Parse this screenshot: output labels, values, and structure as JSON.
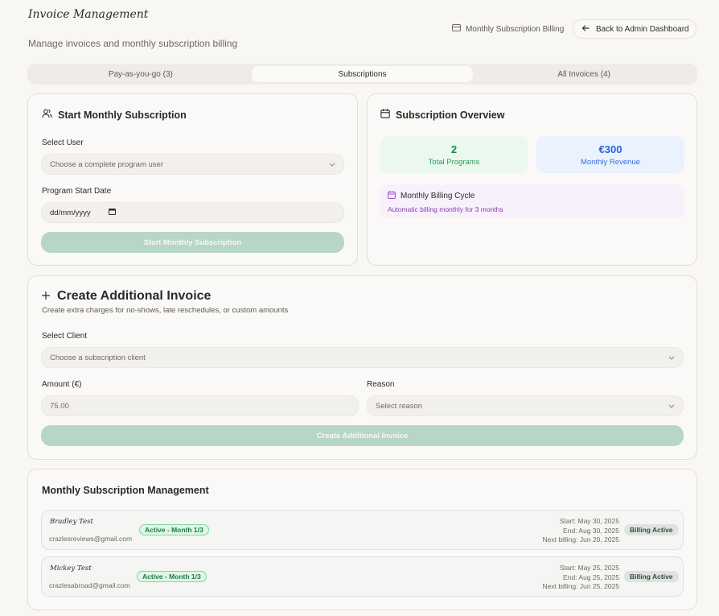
{
  "header": {
    "title": "Invoice Management",
    "subtitle": "Manage invoices and monthly subscription billing",
    "billing_label": "Monthly Subscription Billing",
    "back_label": "Back to Admin Dashboard"
  },
  "tabs": [
    {
      "label": "Pay-as-you-go (3)"
    },
    {
      "label": "Subscriptions"
    },
    {
      "label": "All Invoices (4)"
    }
  ],
  "start_subscription": {
    "title": "Start Monthly Subscription",
    "user_label": "Select User",
    "user_placeholder": "Choose a complete program user",
    "date_label": "Program Start Date",
    "date_placeholder": "dd/mm/yyyy",
    "button_label": "Start Monthly Subscription"
  },
  "overview": {
    "title": "Subscription Overview",
    "programs_value": "2",
    "programs_label": "Total Programs",
    "revenue_value": "€300",
    "revenue_label": "Monthly Revenue",
    "cycle_title": "Monthly Billing Cycle",
    "cycle_text": "Automatic billing monthly for 3 months"
  },
  "additional_invoice": {
    "title": "Create Additional Invoice",
    "subtitle": "Create extra charges for no-shows, late reschedules, or custom amounts",
    "client_label": "Select Client",
    "client_placeholder": "Choose a subscription client",
    "amount_label": "Amount (€)",
    "amount_value": "75.00",
    "reason_label": "Reason",
    "reason_placeholder": "Select reason",
    "button_label": "Create Additional Invoice"
  },
  "management": {
    "title": "Monthly Subscription Management",
    "rows": [
      {
        "name": "Bradley Test",
        "email": "crazlesreviews@gmail.com",
        "status": "Active - Month 1/3",
        "start": "Start: May 30, 2025",
        "end": "End: Aug 30, 2025",
        "next": "Next billing: Jun 20, 2025",
        "badge": "Billing Active"
      },
      {
        "name": "Mickey Test",
        "email": "crazlesabroad@gmail.com",
        "status": "Active - Month 1/3",
        "start": "Start: May 25, 2025",
        "end": "End: Aug 25, 2025",
        "next": "Next billing: Jun 25, 2025",
        "badge": "Billing Active"
      }
    ]
  },
  "colors": {
    "accent_green": "#b8d6c6",
    "programs_green": "#1e8a4c",
    "revenue_blue": "#2a62d6",
    "cycle_purple": "#8a3bb0"
  }
}
